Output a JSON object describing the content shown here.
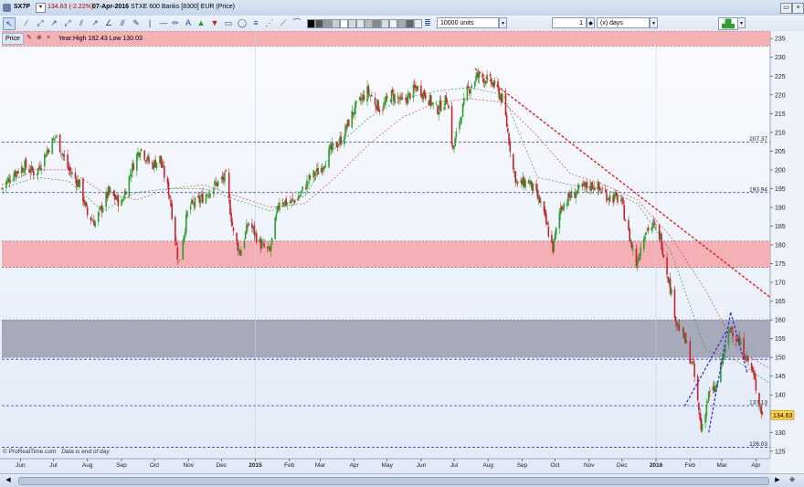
{
  "titlebar": {
    "symbol": "SX7P",
    "change": "134.63 (-2.22%)",
    "date": "07-Apr-2016",
    "description": "STXE 600 Banks [8300] EUR (Price)",
    "units_value": "10000 units",
    "period_value": "1",
    "period_unit": "(x) days"
  },
  "price_panel": {
    "label": "Price",
    "year_high_low": "Year:High 182.43 Low 130.03"
  },
  "footer": {
    "source": "© ProRealTime.com",
    "note": "Data is end of day"
  },
  "colors": {
    "resistance_zone_red": "#f4a9ac",
    "consolidation_zone_grey": "#9fa2b2",
    "bullish_candle": "#2f9e2f",
    "bearish_candle": "#c0272d",
    "trend_line_red": "#dd2222",
    "channel_line_blue": "#2a2ad8",
    "current_price_label": "#ffd24a"
  },
  "chart_data": {
    "type": "candlestick",
    "instrument": "STXE 600 Banks [8300] EUR (Price)",
    "y_axis": {
      "range": [
        123,
        237
      ],
      "ticks": [
        125,
        130,
        135,
        140,
        145,
        150,
        155,
        160,
        165,
        170,
        175,
        180,
        185,
        190,
        195,
        200,
        205,
        210,
        215,
        220,
        225,
        230,
        235
      ]
    },
    "x_axis": {
      "range": [
        "2014-05-15",
        "2016-04-14"
      ],
      "tick_labels": [
        {
          "label": "Jun",
          "date": "2014-06-01"
        },
        {
          "label": "Jul",
          "date": "2014-07-01"
        },
        {
          "label": "Aug",
          "date": "2014-08-01"
        },
        {
          "label": "Sep",
          "date": "2014-09-01"
        },
        {
          "label": "Oct",
          "date": "2014-10-01"
        },
        {
          "label": "Nov",
          "date": "2014-11-01"
        },
        {
          "label": "Dec",
          "date": "2014-12-01"
        },
        {
          "label": "2015",
          "date": "2015-01-01"
        },
        {
          "label": "Feb",
          "date": "2015-02-01"
        },
        {
          "label": "Mar",
          "date": "2015-03-01"
        },
        {
          "label": "Apr",
          "date": "2015-04-01"
        },
        {
          "label": "May",
          "date": "2015-05-01"
        },
        {
          "label": "Jun",
          "date": "2015-06-01"
        },
        {
          "label": "Jul",
          "date": "2015-07-01"
        },
        {
          "label": "Aug",
          "date": "2015-08-01"
        },
        {
          "label": "Sep",
          "date": "2015-09-01"
        },
        {
          "label": "Oct",
          "date": "2015-10-01"
        },
        {
          "label": "Nov",
          "date": "2015-11-01"
        },
        {
          "label": "Dec",
          "date": "2015-12-01"
        },
        {
          "label": "2016",
          "date": "2016-01-01"
        },
        {
          "label": "Feb",
          "date": "2016-02-01"
        },
        {
          "label": "Mar",
          "date": "2016-03-01"
        },
        {
          "label": "Apr",
          "date": "2016-04-01"
        }
      ]
    },
    "last_price": 134.63,
    "horizontal_levels": [
      {
        "value": 207.37,
        "label": "207.37"
      },
      {
        "value": 193.94,
        "label": "193.94"
      },
      {
        "value": 149.5,
        "label": ""
      },
      {
        "value": 137.13,
        "label": "137.13"
      },
      {
        "value": 126.03,
        "label": "126.03"
      }
    ],
    "zones": [
      {
        "from": 233.0,
        "to": 237.0,
        "color": "#f4a9ac"
      },
      {
        "from": 174.0,
        "to": 181.0,
        "color": "#f4a9ac"
      },
      {
        "from": 150.0,
        "to": 160.0,
        "color": "#9fa2b2"
      }
    ],
    "trend_lines": [
      {
        "from": {
          "date": "2015-07-20",
          "value": 227
        },
        "to": {
          "date": "2016-04-14",
          "value": 166
        },
        "color": "#dd2222",
        "style": "dashed"
      },
      {
        "from": {
          "date": "2016-02-18",
          "value": 130
        },
        "to": {
          "date": "2016-03-09",
          "value": 162
        },
        "color": "#2a2ad8",
        "style": "dashed"
      },
      {
        "from": {
          "date": "2016-01-27",
          "value": 137
        },
        "to": {
          "date": "2016-03-05",
          "value": 157
        },
        "color": "#2a2ad8",
        "style": "dashed"
      },
      {
        "from": {
          "date": "2016-03-09",
          "value": 162
        },
        "to": {
          "date": "2016-03-24",
          "value": 146
        },
        "color": "#2a2ad8",
        "style": "dashed"
      }
    ],
    "moving_average_1": [
      [
        "2014-05-15",
        196
      ],
      [
        "2014-06-15",
        200
      ],
      [
        "2014-07-15",
        200
      ],
      [
        "2014-08-15",
        194
      ],
      [
        "2014-09-15",
        192
      ],
      [
        "2014-10-15",
        195
      ],
      [
        "2014-11-15",
        196
      ],
      [
        "2014-12-15",
        193
      ],
      [
        "2015-01-15",
        190
      ],
      [
        "2015-02-15",
        191
      ],
      [
        "2015-03-15",
        198
      ],
      [
        "2015-04-15",
        207
      ],
      [
        "2015-05-15",
        214
      ],
      [
        "2015-06-15",
        218
      ],
      [
        "2015-07-15",
        219
      ],
      [
        "2015-08-15",
        218
      ],
      [
        "2015-09-15",
        209
      ],
      [
        "2015-10-15",
        199
      ],
      [
        "2015-11-15",
        196
      ],
      [
        "2015-12-15",
        192
      ],
      [
        "2016-01-15",
        182
      ],
      [
        "2016-02-15",
        168
      ],
      [
        "2016-03-15",
        152
      ],
      [
        "2016-04-14",
        147
      ]
    ],
    "moving_average_2": [
      [
        "2014-05-15",
        195
      ],
      [
        "2014-06-15",
        198
      ],
      [
        "2014-07-15",
        197
      ],
      [
        "2014-08-15",
        189
      ],
      [
        "2014-09-15",
        194
      ],
      [
        "2014-10-15",
        195
      ],
      [
        "2014-11-15",
        195
      ],
      [
        "2014-12-15",
        192
      ],
      [
        "2015-01-15",
        189
      ],
      [
        "2015-02-15",
        193
      ],
      [
        "2015-03-15",
        206
      ],
      [
        "2015-04-15",
        214
      ],
      [
        "2015-05-15",
        219
      ],
      [
        "2015-06-15",
        221
      ],
      [
        "2015-07-15",
        222
      ],
      [
        "2015-08-15",
        220
      ],
      [
        "2015-09-15",
        198
      ],
      [
        "2015-10-15",
        196
      ],
      [
        "2015-11-15",
        195
      ],
      [
        "2015-12-15",
        191
      ],
      [
        "2016-01-15",
        178
      ],
      [
        "2016-02-15",
        152
      ],
      [
        "2016-03-15",
        149
      ],
      [
        "2016-04-14",
        143
      ]
    ],
    "close_path": [
      [
        "2014-05-15",
        195
      ],
      [
        "2014-05-25",
        199
      ],
      [
        "2014-06-05",
        201
      ],
      [
        "2014-06-15",
        199
      ],
      [
        "2014-06-25",
        205
      ],
      [
        "2014-07-03",
        209
      ],
      [
        "2014-07-15",
        200
      ],
      [
        "2014-07-25",
        196
      ],
      [
        "2014-08-01",
        188
      ],
      [
        "2014-08-08",
        186
      ],
      [
        "2014-08-20",
        194
      ],
      [
        "2014-09-01",
        191
      ],
      [
        "2014-09-10",
        200
      ],
      [
        "2014-09-18",
        206
      ],
      [
        "2014-09-28",
        201
      ],
      [
        "2014-10-06",
        203
      ],
      [
        "2014-10-15",
        193
      ],
      [
        "2014-10-23",
        175
      ],
      [
        "2014-11-01",
        190
      ],
      [
        "2014-11-12",
        192
      ],
      [
        "2014-11-25",
        196
      ],
      [
        "2014-12-05",
        198
      ],
      [
        "2014-12-12",
        183
      ],
      [
        "2014-12-18",
        178
      ],
      [
        "2014-12-26",
        186
      ],
      [
        "2015-01-06",
        180
      ],
      [
        "2015-01-14",
        178
      ],
      [
        "2015-01-23",
        192
      ],
      [
        "2015-02-01",
        191
      ],
      [
        "2015-02-10",
        193
      ],
      [
        "2015-02-20",
        198
      ],
      [
        "2015-03-01",
        200
      ],
      [
        "2015-03-10",
        205
      ],
      [
        "2015-03-20",
        208
      ],
      [
        "2015-04-01",
        216
      ],
      [
        "2015-04-13",
        221
      ],
      [
        "2015-04-25",
        216
      ],
      [
        "2015-05-05",
        220
      ],
      [
        "2015-05-15",
        218
      ],
      [
        "2015-05-28",
        222
      ],
      [
        "2015-06-05",
        220
      ],
      [
        "2015-06-15",
        216
      ],
      [
        "2015-06-25",
        219
      ],
      [
        "2015-06-30",
        205
      ],
      [
        "2015-07-05",
        212
      ],
      [
        "2015-07-13",
        221
      ],
      [
        "2015-07-22",
        225
      ],
      [
        "2015-08-01",
        224
      ],
      [
        "2015-08-08",
        222
      ],
      [
        "2015-08-15",
        218
      ],
      [
        "2015-08-24",
        200
      ],
      [
        "2015-08-28",
        196
      ],
      [
        "2015-09-07",
        197
      ],
      [
        "2015-09-18",
        191
      ],
      [
        "2015-09-29",
        179
      ],
      [
        "2015-10-06",
        190
      ],
      [
        "2015-10-15",
        193
      ],
      [
        "2015-10-25",
        195
      ],
      [
        "2015-11-05",
        196
      ],
      [
        "2015-11-18",
        193
      ],
      [
        "2015-11-30",
        192
      ],
      [
        "2015-12-07",
        183
      ],
      [
        "2015-12-14",
        175
      ],
      [
        "2015-12-22",
        184
      ],
      [
        "2015-12-30",
        185
      ],
      [
        "2016-01-05",
        182
      ],
      [
        "2016-01-13",
        170
      ],
      [
        "2016-01-20",
        159
      ],
      [
        "2016-01-27",
        155
      ],
      [
        "2016-02-04",
        147
      ],
      [
        "2016-02-11",
        131
      ],
      [
        "2016-02-18",
        140
      ],
      [
        "2016-02-25",
        142
      ],
      [
        "2016-03-02",
        150
      ],
      [
        "2016-03-09",
        158
      ],
      [
        "2016-03-15",
        155
      ],
      [
        "2016-03-22",
        151
      ],
      [
        "2016-03-29",
        146
      ],
      [
        "2016-04-04",
        138
      ],
      [
        "2016-04-07",
        134.63
      ]
    ]
  }
}
